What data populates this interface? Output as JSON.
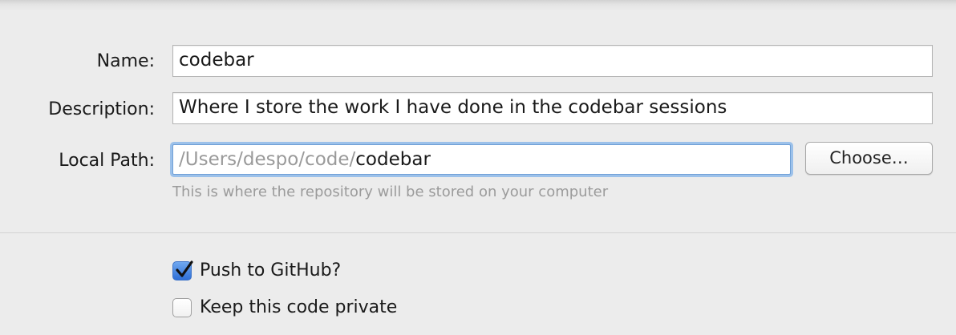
{
  "form": {
    "name": {
      "label": "Name:",
      "value": "codebar"
    },
    "description": {
      "label": "Description:",
      "value": "Where I store the work I have done in the codebar sessions"
    },
    "local_path": {
      "label": "Local Path:",
      "prefix": "/Users/despo/code/",
      "value": "codebar",
      "hint": "This is where the repository will be stored on your computer",
      "choose_label": "Choose…"
    }
  },
  "options": {
    "push_to_github": {
      "label": "Push to GitHub?",
      "checked": true
    },
    "keep_private": {
      "label": "Keep this code private",
      "checked": false
    }
  },
  "colors": {
    "background": "#ececec",
    "focus_ring": "#9cc1ea",
    "checkbox_accent": "#2f6fd6",
    "hint_text": "#9b9b9b"
  }
}
